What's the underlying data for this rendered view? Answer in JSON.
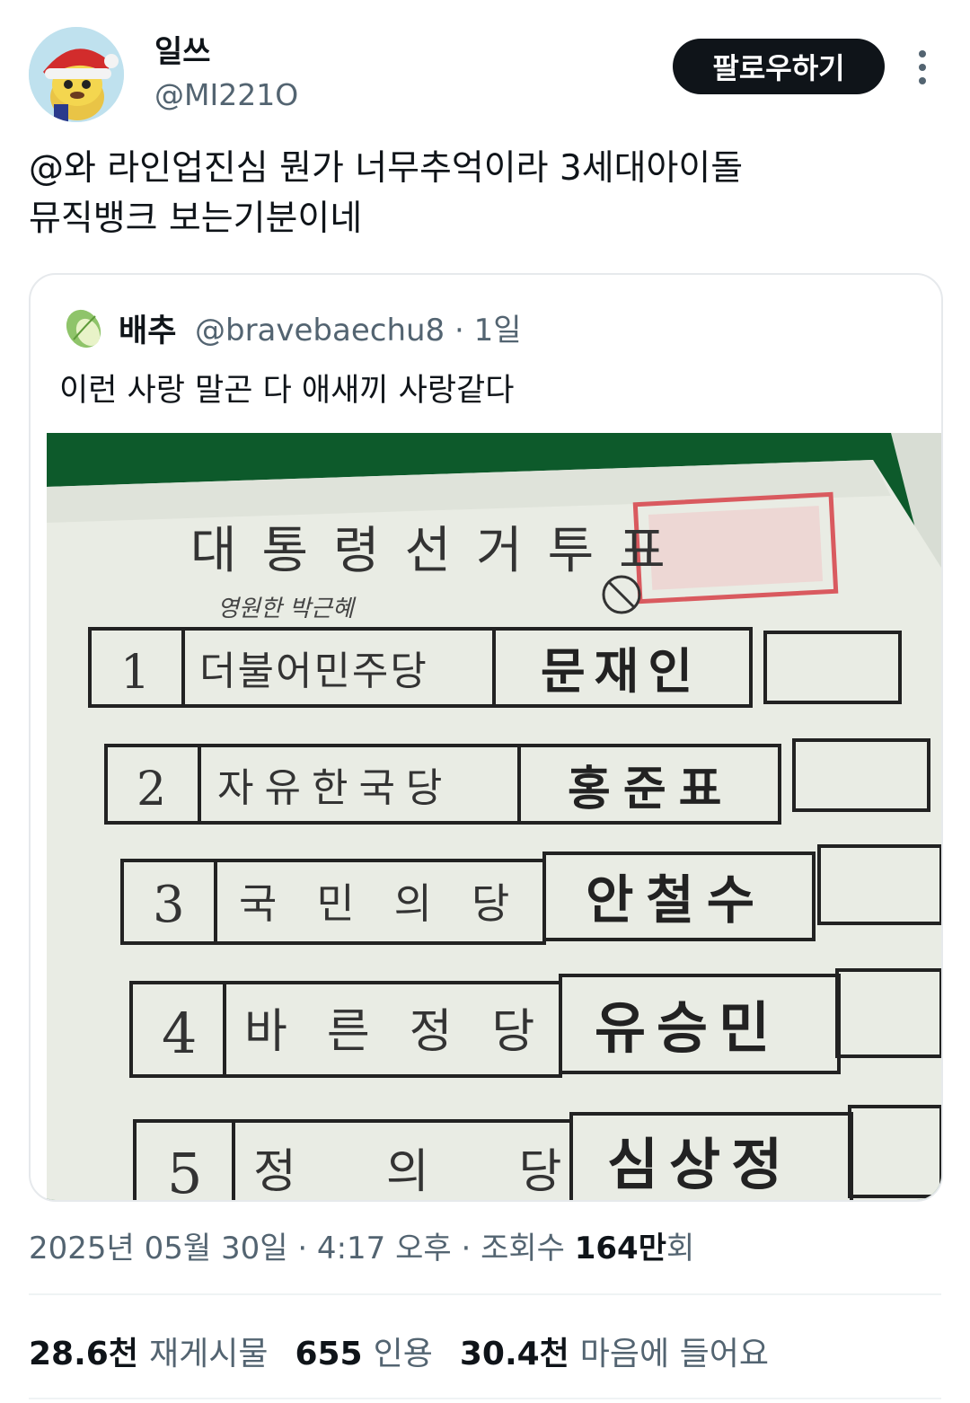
{
  "author": {
    "name": "일쓰",
    "handle": "@MI221O"
  },
  "follow_label": "팔로우하기",
  "tweet_text": [
    "@와 라인업진심 뭔가 너무추억이라 3세대아이돌",
    "뮤직뱅크 보는기분이네"
  ],
  "quoted": {
    "name": "배추",
    "handle": "@bravebaechu8 · 1일",
    "text": "이런 사랑 말곤 다 애새끼 사랑같다",
    "ballot": {
      "title": "대통령선거투표",
      "scribble": "영원한 박근혜",
      "rows": [
        {
          "num": "1",
          "party": "더불어민주당",
          "candidate": "문재인"
        },
        {
          "num": "2",
          "party": "자유한국당",
          "candidate": "홍준표"
        },
        {
          "num": "3",
          "party": "국민의당",
          "candidate": "안철수"
        },
        {
          "num": "4",
          "party": "바른정당",
          "candidate": "유승민"
        },
        {
          "num": "5",
          "party": "정의당",
          "candidate": "심상정"
        }
      ]
    }
  },
  "meta": {
    "date": "2025년 05월 30일 · 4:17 오후 · 조회수 ",
    "views": "164만",
    "views_suffix": "회"
  },
  "stats": {
    "retweets": "28.6천",
    "retweets_label": "재게시물",
    "quotes": "655",
    "quotes_label": "인용",
    "likes": "30.4천",
    "likes_label": "마음에 들어요"
  },
  "colors": {
    "follow_bg": "#0f1419",
    "ballot_bg": "#0d5a2b",
    "paper": "#e9ece4",
    "stamp": "#d95a5f"
  }
}
